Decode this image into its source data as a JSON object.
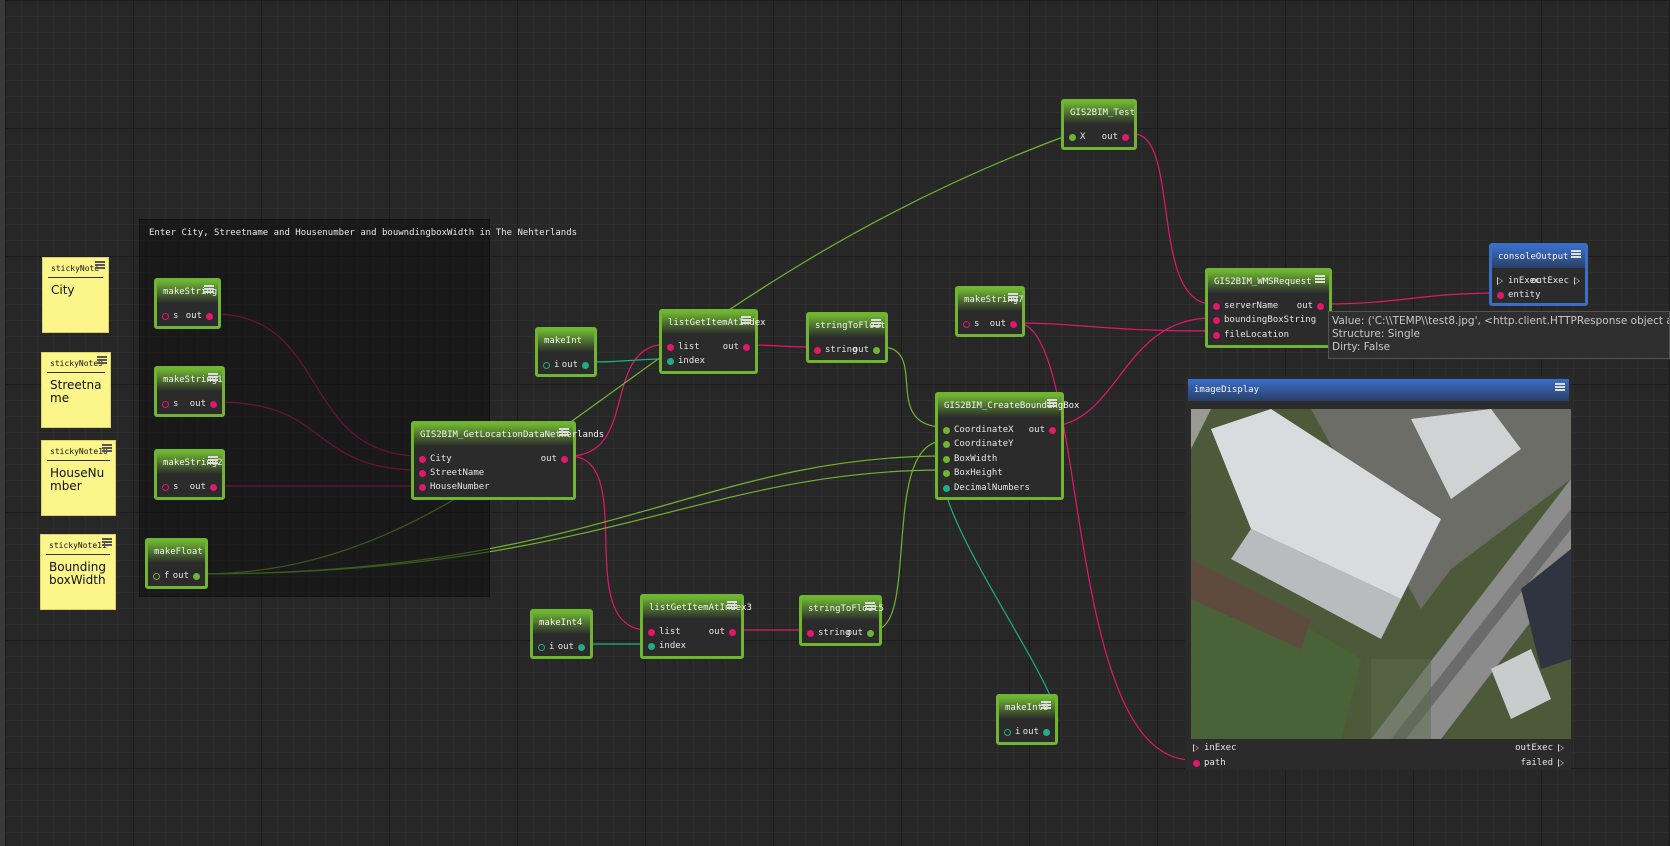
{
  "backdrop": {
    "title": "Enter City, Streetname and Housenumber and bouwndingboxWidth in The Nehterlands"
  },
  "sticky_notes": [
    {
      "title": "stickyNote",
      "text": "City"
    },
    {
      "title": "stickyNote9",
      "text": "Streetname"
    },
    {
      "title": "stickyNote10",
      "text": "HouseNumber"
    },
    {
      "title": "stickyNote11",
      "text": "BoundingboxWidth"
    }
  ],
  "nodes": {
    "makeString": {
      "title": "makeString",
      "in": "s",
      "out": "out"
    },
    "makeString1": {
      "title": "makeString1",
      "in": "s",
      "out": "out"
    },
    "makeString2": {
      "title": "makeString2",
      "in": "s",
      "out": "out"
    },
    "makeFloat": {
      "title": "makeFloat",
      "in": "f",
      "out": "out"
    },
    "getLocation": {
      "title": "GIS2BIM_GetLocationDataNetherlands",
      "inputs": [
        "City",
        "StreetName",
        "HouseNumber"
      ],
      "out": "out"
    },
    "makeInt": {
      "title": "makeInt",
      "in": "i",
      "out": "out"
    },
    "listGetItem": {
      "title": "listGetItemAtIndex",
      "inputs": [
        "list",
        "index"
      ],
      "out": "out"
    },
    "stringToFloat": {
      "title": "stringToFloat",
      "in": "string",
      "out": "out"
    },
    "makeInt4": {
      "title": "makeInt4",
      "in": "i",
      "out": "out"
    },
    "listGetItem3": {
      "title": "listGetItemAtIndex3",
      "inputs": [
        "list",
        "index"
      ],
      "out": "out"
    },
    "stringToFloat5": {
      "title": "stringToFloat5",
      "in": "string",
      "out": "out"
    },
    "gisTest": {
      "title": "GIS2BIM_Test",
      "in": "X",
      "out": "out"
    },
    "makeString7": {
      "title": "makeString7",
      "in": "s",
      "out": "out"
    },
    "boundingBox": {
      "title": "GIS2BIM_CreateBoundingBox",
      "inputs": [
        "CoordinateX",
        "CoordinateY",
        "BoxWidth",
        "BoxHeight",
        "DecimalNumbers"
      ],
      "out": "out"
    },
    "makeInt6": {
      "title": "makeInt6",
      "in": "i",
      "out": "out"
    },
    "wmsRequest": {
      "title": "GIS2BIM_WMSRequest",
      "inputs": [
        "serverName",
        "boundingBoxString",
        "fileLocation"
      ],
      "out": "out"
    },
    "consoleOutput": {
      "title": "consoleOutput",
      "in_exec": "inExec",
      "out_exec": "outExec",
      "in": "entity"
    },
    "imageDisplay": {
      "title": "imageDisplay",
      "in_exec": "inExec",
      "out_exec": "outExec",
      "in": "path",
      "out": "failed"
    }
  },
  "tooltip": {
    "line1": "Value: ('C:\\\\TEMP\\\\test8.jpg', <http.client.HTTPResponse object at 0",
    "line2": "Structure: Single",
    "line3": "Dirty: False"
  },
  "colors": {
    "node_border": "#6fb532",
    "wire_string": "#e2186e",
    "wire_float": "#6fb532",
    "wire_int": "#1fae86",
    "console_header": "#3a6ecc"
  }
}
